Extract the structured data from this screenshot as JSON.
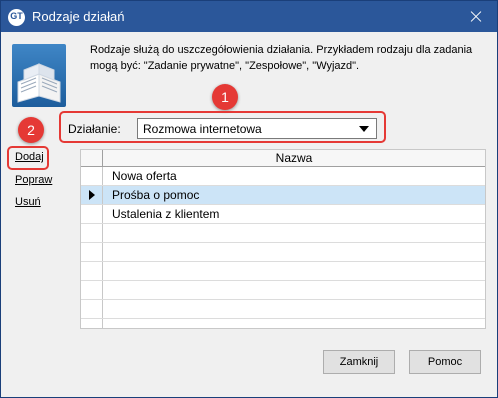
{
  "window": {
    "title": "Rodzaje działań",
    "app_icon_text": "GT"
  },
  "description": {
    "line1": "Rodzaje służą do uszczegółowienia działania. Przykładem rodzaju dla zadania",
    "line2": "mogą być: \"Zadanie prywatne\", \"Zespołowe\", \"Wyjazd\"."
  },
  "annotations": {
    "badge1": "1",
    "badge2": "2",
    "color": "#e53935"
  },
  "action": {
    "label": "Działanie:",
    "selected": "Rozmowa internetowa"
  },
  "side_links": {
    "add": "Dodaj",
    "edit": "Popraw",
    "delete": "Usuń"
  },
  "table": {
    "header": "Nazwa",
    "rows": [
      {
        "name": "Nowa oferta",
        "selected": false
      },
      {
        "name": "Prośba o pomoc",
        "selected": true
      },
      {
        "name": "Ustalenia z klientem",
        "selected": false
      }
    ]
  },
  "buttons": {
    "close": "Zamknij",
    "help": "Pomoc"
  },
  "colors": {
    "titlebar": "#2b579a",
    "selection": "#cce4f7"
  }
}
